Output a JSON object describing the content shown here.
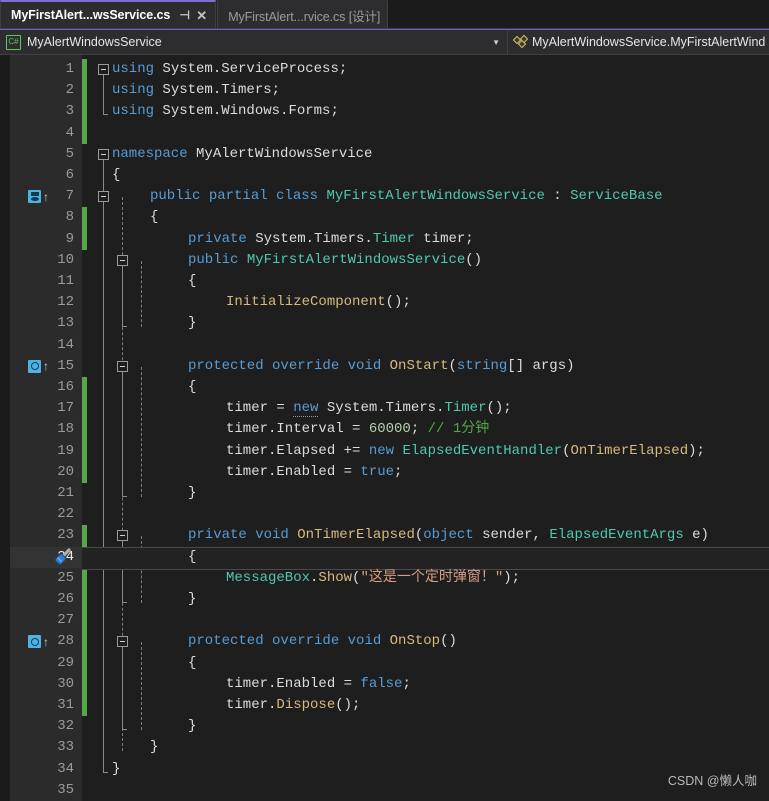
{
  "window": {
    "theme_background": "#1e1e1e",
    "accent": "#7e6fd4"
  },
  "tabs": [
    {
      "title": "MyFirstAlert...wsService.cs",
      "active": true,
      "pin_glyph": "⊣",
      "close_glyph": "✕"
    },
    {
      "title": "MyFirstAlert...rvice.cs [设计]",
      "active": false
    }
  ],
  "navbar": {
    "left": {
      "icon": "csharp-icon",
      "icon_label": "C#",
      "text": "MyAlertWindowsService",
      "caret": "▼"
    },
    "right": {
      "icon": "method-icon",
      "text": "MyAlertWindowsService.MyFirstAlertWind"
    }
  },
  "editor": {
    "current_line": 24,
    "codelens": [
      {
        "line": 7,
        "type": "double"
      },
      {
        "line": 15,
        "type": "single"
      },
      {
        "line": 28,
        "type": "single"
      }
    ],
    "quick_action_line": 24,
    "lines": [
      {
        "n": 1,
        "tokens": [
          {
            "t": "using ",
            "c": "k"
          },
          {
            "t": "System.ServiceProcess;",
            "c": "id"
          }
        ],
        "indent": 0
      },
      {
        "n": 2,
        "tokens": [
          {
            "t": "using ",
            "c": "k"
          },
          {
            "t": "System.Timers;",
            "c": "id"
          }
        ],
        "indent": 0
      },
      {
        "n": 3,
        "tokens": [
          {
            "t": "using ",
            "c": "k"
          },
          {
            "t": "System.Windows.Forms;",
            "c": "id"
          }
        ],
        "indent": 0
      },
      {
        "n": 4,
        "tokens": [],
        "indent": 0
      },
      {
        "n": 5,
        "tokens": [
          {
            "t": "namespace ",
            "c": "k"
          },
          {
            "t": "MyAlertWindowsService",
            "c": "id"
          }
        ],
        "indent": 0
      },
      {
        "n": 6,
        "tokens": [
          {
            "t": "{",
            "c": "br"
          }
        ],
        "indent": 0
      },
      {
        "n": 7,
        "tokens": [
          {
            "t": "public ",
            "c": "k"
          },
          {
            "t": "partial ",
            "c": "k"
          },
          {
            "t": "class ",
            "c": "k"
          },
          {
            "t": "MyFirstAlertWindowsService",
            "c": "t"
          },
          {
            "t": " : ",
            "c": "p"
          },
          {
            "t": "ServiceBase",
            "c": "t"
          }
        ],
        "indent": 1
      },
      {
        "n": 8,
        "tokens": [
          {
            "t": "{",
            "c": "br"
          }
        ],
        "indent": 1
      },
      {
        "n": 9,
        "tokens": [
          {
            "t": "private ",
            "c": "k"
          },
          {
            "t": "System.Timers.",
            "c": "id"
          },
          {
            "t": "Timer",
            "c": "t"
          },
          {
            "t": " timer;",
            "c": "id"
          }
        ],
        "indent": 2
      },
      {
        "n": 10,
        "tokens": [
          {
            "t": "public ",
            "c": "k"
          },
          {
            "t": "MyFirstAlertWindowsService",
            "c": "t"
          },
          {
            "t": "()",
            "c": "p"
          }
        ],
        "indent": 2
      },
      {
        "n": 11,
        "tokens": [
          {
            "t": "{",
            "c": "br"
          }
        ],
        "indent": 2
      },
      {
        "n": 12,
        "tokens": [
          {
            "t": "InitializeComponent",
            "c": "ctl"
          },
          {
            "t": "();",
            "c": "p"
          }
        ],
        "indent": 3
      },
      {
        "n": 13,
        "tokens": [
          {
            "t": "}",
            "c": "br"
          }
        ],
        "indent": 2
      },
      {
        "n": 14,
        "tokens": [],
        "indent": 0
      },
      {
        "n": 15,
        "tokens": [
          {
            "t": "protected ",
            "c": "k"
          },
          {
            "t": "override ",
            "c": "k"
          },
          {
            "t": "void ",
            "c": "k"
          },
          {
            "t": "OnStart",
            "c": "ctl"
          },
          {
            "t": "(",
            "c": "p"
          },
          {
            "t": "string",
            "c": "k"
          },
          {
            "t": "[] args)",
            "c": "id"
          }
        ],
        "indent": 2
      },
      {
        "n": 16,
        "tokens": [
          {
            "t": "{",
            "c": "br"
          }
        ],
        "indent": 2
      },
      {
        "n": 17,
        "tokens": [
          {
            "t": "timer = ",
            "c": "id"
          },
          {
            "t": "new",
            "c": "k",
            "sq": true
          },
          {
            "t": " System.Timers.",
            "c": "id"
          },
          {
            "t": "Timer",
            "c": "t"
          },
          {
            "t": "();",
            "c": "p"
          }
        ],
        "indent": 3
      },
      {
        "n": 18,
        "tokens": [
          {
            "t": "timer.Interval = ",
            "c": "id"
          },
          {
            "t": "60000",
            "c": "n"
          },
          {
            "t": "; ",
            "c": "p"
          },
          {
            "t": "// 1分钟",
            "c": "c"
          }
        ],
        "indent": 3
      },
      {
        "n": 19,
        "tokens": [
          {
            "t": "timer.Elapsed += ",
            "c": "id"
          },
          {
            "t": "new ",
            "c": "k"
          },
          {
            "t": "ElapsedEventHandler",
            "c": "t"
          },
          {
            "t": "(",
            "c": "p"
          },
          {
            "t": "OnTimerElapsed",
            "c": "ctl"
          },
          {
            "t": ");",
            "c": "p"
          }
        ],
        "indent": 3
      },
      {
        "n": 20,
        "tokens": [
          {
            "t": "timer.Enabled = ",
            "c": "id"
          },
          {
            "t": "true",
            "c": "k"
          },
          {
            "t": ";",
            "c": "p"
          }
        ],
        "indent": 3
      },
      {
        "n": 21,
        "tokens": [
          {
            "t": "}",
            "c": "br"
          }
        ],
        "indent": 2
      },
      {
        "n": 22,
        "tokens": [],
        "indent": 0
      },
      {
        "n": 23,
        "tokens": [
          {
            "t": "private ",
            "c": "k"
          },
          {
            "t": "void ",
            "c": "k"
          },
          {
            "t": "OnTimerElapsed",
            "c": "ctl"
          },
          {
            "t": "(",
            "c": "p"
          },
          {
            "t": "object",
            "c": "k"
          },
          {
            "t": " sender, ",
            "c": "id"
          },
          {
            "t": "ElapsedEventArgs",
            "c": "t"
          },
          {
            "t": " e)",
            "c": "id"
          }
        ],
        "indent": 2
      },
      {
        "n": 24,
        "tokens": [
          {
            "t": "{",
            "c": "br"
          }
        ],
        "indent": 2
      },
      {
        "n": 25,
        "tokens": [
          {
            "t": "MessageBox",
            "c": "t"
          },
          {
            "t": ".",
            "c": "p"
          },
          {
            "t": "Show",
            "c": "ctl"
          },
          {
            "t": "(",
            "c": "p"
          },
          {
            "t": "\"这是一个定时弹窗！\"",
            "c": "s"
          },
          {
            "t": ");",
            "c": "p"
          }
        ],
        "indent": 3
      },
      {
        "n": 26,
        "tokens": [
          {
            "t": "}",
            "c": "br"
          }
        ],
        "indent": 2
      },
      {
        "n": 27,
        "tokens": [],
        "indent": 0
      },
      {
        "n": 28,
        "tokens": [
          {
            "t": "protected ",
            "c": "k"
          },
          {
            "t": "override ",
            "c": "k"
          },
          {
            "t": "void ",
            "c": "k"
          },
          {
            "t": "OnStop",
            "c": "ctl"
          },
          {
            "t": "()",
            "c": "p"
          }
        ],
        "indent": 2
      },
      {
        "n": 29,
        "tokens": [
          {
            "t": "{",
            "c": "br"
          }
        ],
        "indent": 2
      },
      {
        "n": 30,
        "tokens": [
          {
            "t": "timer.Enabled = ",
            "c": "id"
          },
          {
            "t": "false",
            "c": "k"
          },
          {
            "t": ";",
            "c": "p"
          }
        ],
        "indent": 3
      },
      {
        "n": 31,
        "tokens": [
          {
            "t": "timer.",
            "c": "id"
          },
          {
            "t": "Dispose",
            "c": "ctl"
          },
          {
            "t": "();",
            "c": "p"
          }
        ],
        "indent": 3
      },
      {
        "n": 32,
        "tokens": [
          {
            "t": "}",
            "c": "br"
          }
        ],
        "indent": 2
      },
      {
        "n": 33,
        "tokens": [
          {
            "t": "}",
            "c": "br"
          }
        ],
        "indent": 1
      },
      {
        "n": 34,
        "tokens": [
          {
            "t": "}",
            "c": "br"
          }
        ],
        "indent": 0
      },
      {
        "n": 35,
        "tokens": [],
        "indent": 0
      }
    ],
    "change_bars": [
      {
        "from": 1,
        "to": 4
      },
      {
        "from": 8,
        "to": 9
      },
      {
        "from": 16,
        "to": 20
      },
      {
        "from": 23,
        "to": 31
      }
    ],
    "folds": [
      1,
      5,
      7,
      10,
      15,
      23,
      28
    ]
  },
  "watermark": {
    "text": "CSDN @懒人咖"
  }
}
